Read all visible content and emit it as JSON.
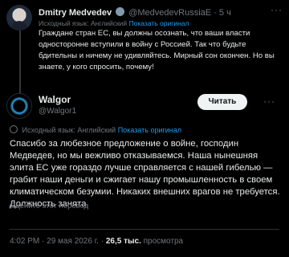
{
  "tweet1": {
    "author_name": "Dmitry Medvedev",
    "handle": "@MedvedevRussiaE",
    "separator": "·",
    "time": "5 ч",
    "more_icon": "more-dots-icon",
    "translation": {
      "prefix": "Исходный язык: Английский",
      "link": "Показать оригинал"
    },
    "text": "Граждане стран ЕС, вы должны осознать, что ваши власти односторонне вступили в войну с Россией. Так что будьте бдительны и ничему не удивляйтесь. Мирный сон окончен. Но вы знаете, у кого спросить, почему!"
  },
  "tweet2": {
    "author_name": "Walgor",
    "handle": "@Walgor1",
    "follow_label": "Читать",
    "more_icon": "more-dots-icon",
    "translation": {
      "prefix": "Исходный язык: Английский",
      "link": "Показать оригинал"
    },
    "text": "Спасибо за любезное предложение о войне, господин Медведев, но мы вежливо отказываемся. Наша нынешняя элита ЕС уже гораздо лучше справляется с нашей гибелью — грабит наши деньги и сжигает нашу промышленность в своем климатическом безумии. Никаких внешних врагов не требуется. Должность занята.",
    "rate_translation": "Оцените этот перевод",
    "time": "4:02 PM",
    "date": "29 мая 2026 г.",
    "separator": "·",
    "views_count": "26,5 тыс.",
    "views_label": "просмотра"
  },
  "colors": {
    "background": "#000000",
    "text": "#e7e9ea",
    "muted": "#71767b",
    "link": "#1d9bf0",
    "follow_button_bg": "#eff3f4"
  }
}
